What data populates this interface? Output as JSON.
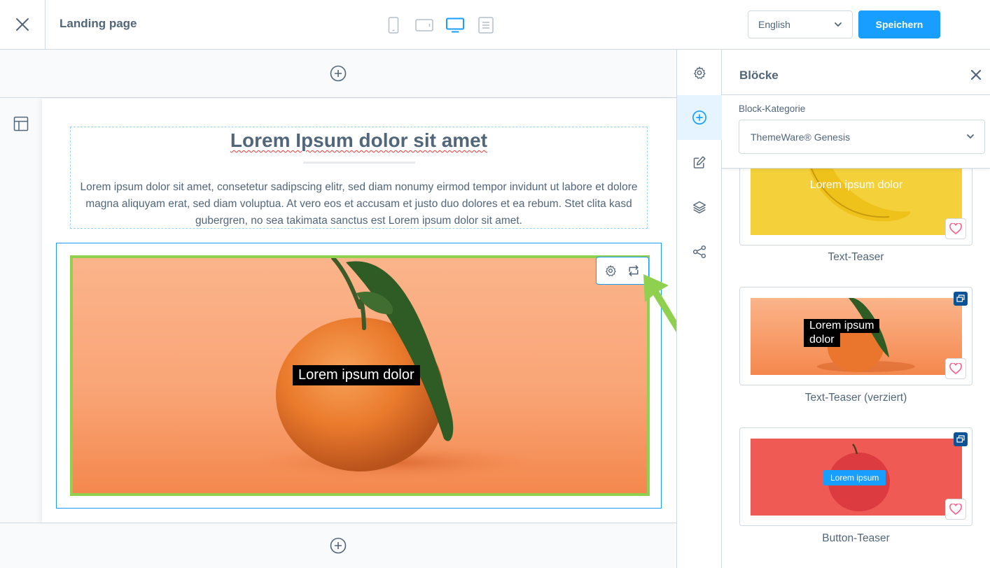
{
  "header": {
    "title": "Landing page",
    "language": "English",
    "save_label": "Speichern",
    "devices": [
      "mobile",
      "tablet",
      "desktop",
      "list"
    ],
    "active_device": "desktop"
  },
  "canvas": {
    "heading": "Lorem Ipsum dolor sit amet",
    "paragraph": "Lorem ipsum dolor sit amet, consetetur sadipscing elitr, sed diam nonumy eirmod tempor invidunt ut labore et dolore magna aliquyam erat, sed diam voluptua. At vero eos et accusam et justo duo dolores et ea rebum. Stet clita kasd gubergren, no sea takimata sanctus est Lorem ipsum dolor sit amet.",
    "image_overlay_text": "Lorem ipsum dolor"
  },
  "rail": {
    "items": [
      "gear-icon",
      "plus-circle-icon",
      "edit-icon",
      "layers-icon",
      "share-icon"
    ],
    "active": "plus-circle-icon"
  },
  "panel": {
    "title": "Blöcke",
    "category_label": "Block-Kategorie",
    "category_value": "ThemeWare® Genesis",
    "cards": [
      {
        "name": "Text-Teaser",
        "preview_text": "Lorem ipsum dolor"
      },
      {
        "name": "Text-Teaser (verziert)",
        "preview_text_line1": "Lorem ipsum",
        "preview_text_line2": "dolor"
      },
      {
        "name": "Button-Teaser",
        "preview_button": "Lorem ipsum"
      }
    ]
  },
  "colors": {
    "accent": "#189eff",
    "selection": "#8fd14f",
    "text": "#52667a",
    "border": "#d1d9e0"
  }
}
